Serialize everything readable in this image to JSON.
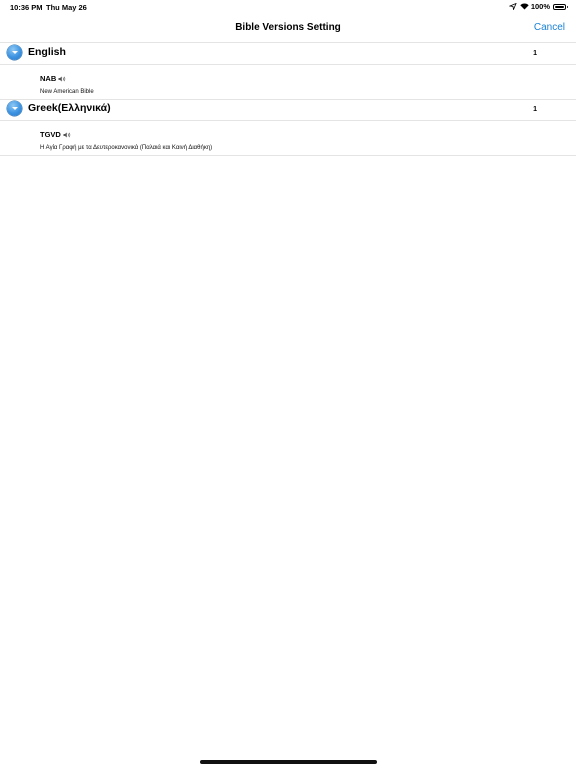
{
  "status_bar": {
    "time": "10:36 PM",
    "date": "Thu May 26",
    "battery_percent": "100%",
    "icons": [
      "location-icon",
      "wifi-icon",
      "battery-icon"
    ]
  },
  "nav": {
    "title": "Bible Versions Setting",
    "cancel_label": "Cancel"
  },
  "colors": {
    "accent": "#1a82d6",
    "disclosure": "#3c93e0",
    "separator": "#e4e4e4"
  },
  "sections": [
    {
      "title": "English",
      "count": "1",
      "versions": [
        {
          "code": "NAB",
          "name": "New American Bible",
          "icon": "speaker-icon"
        }
      ]
    },
    {
      "title": "Greek(Ελληνικά)",
      "count": "1",
      "versions": [
        {
          "code": "TGVD",
          "name": "Η Αγία Γραφή με τα Δευτεροκανονικά (Παλαιά και Καινή Διαθήκη)",
          "icon": "speaker-icon"
        }
      ]
    }
  ]
}
